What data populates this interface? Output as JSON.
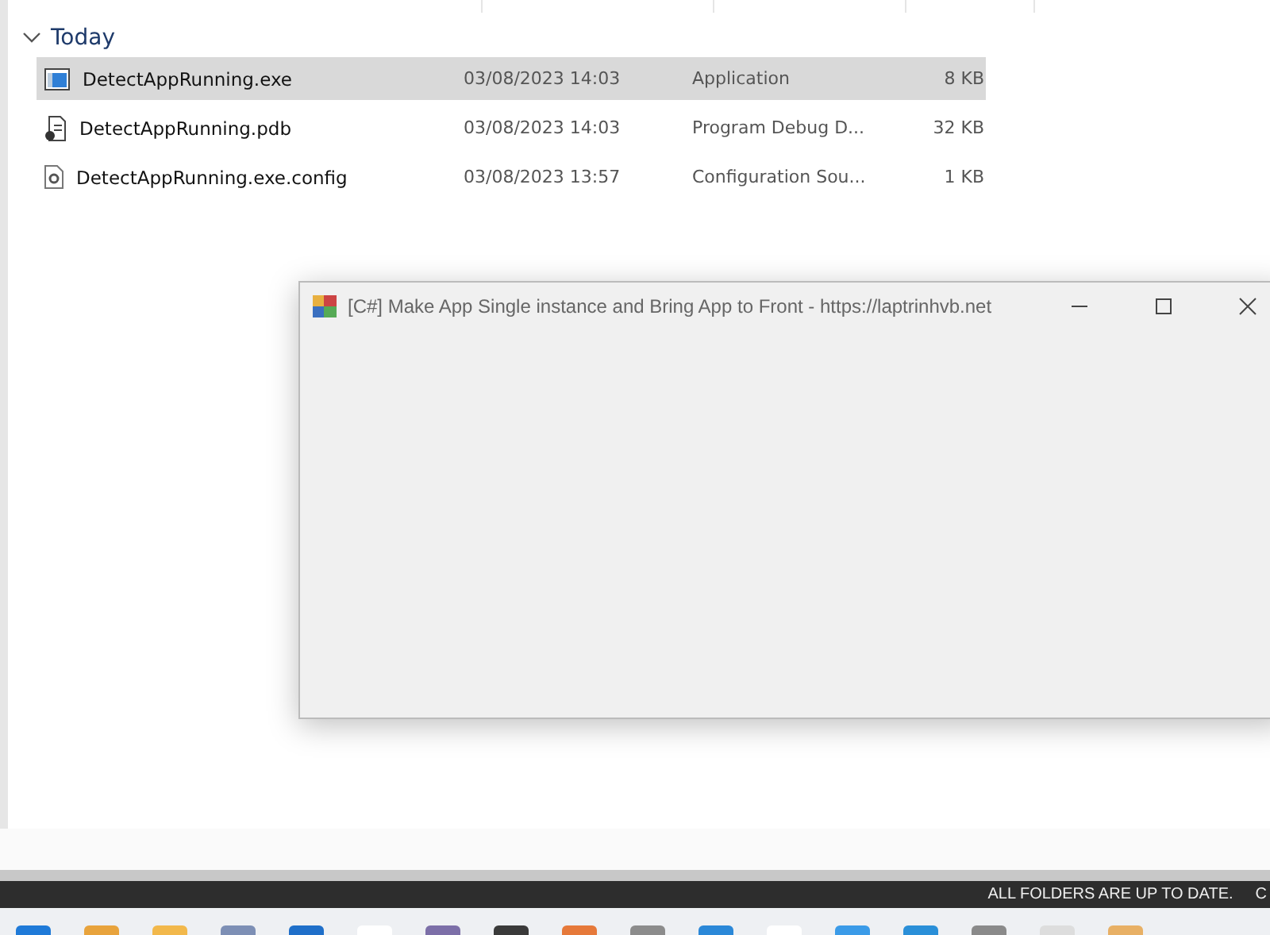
{
  "explorer": {
    "group": {
      "label": "Today",
      "expanded": true
    },
    "files": [
      {
        "kind": "exe",
        "name": "DetectAppRunning.exe",
        "date": "03/08/2023 14:03",
        "type": "Application",
        "size": "8 KB",
        "selected": true
      },
      {
        "kind": "pdb",
        "name": "DetectAppRunning.pdb",
        "date": "03/08/2023 14:03",
        "type": "Program Debug D...",
        "size": "32 KB",
        "selected": false
      },
      {
        "kind": "config",
        "name": "DetectAppRunning.exe.config",
        "date": "03/08/2023 13:57",
        "type": "Configuration Sou...",
        "size": "1 KB",
        "selected": false
      }
    ]
  },
  "window": {
    "title": "[C#] Make App Single instance and Bring App to Front - https://laptrinhvb.net"
  },
  "status_bar": {
    "message": "ALL FOLDERS ARE UP TO DATE.",
    "extra": "C"
  }
}
